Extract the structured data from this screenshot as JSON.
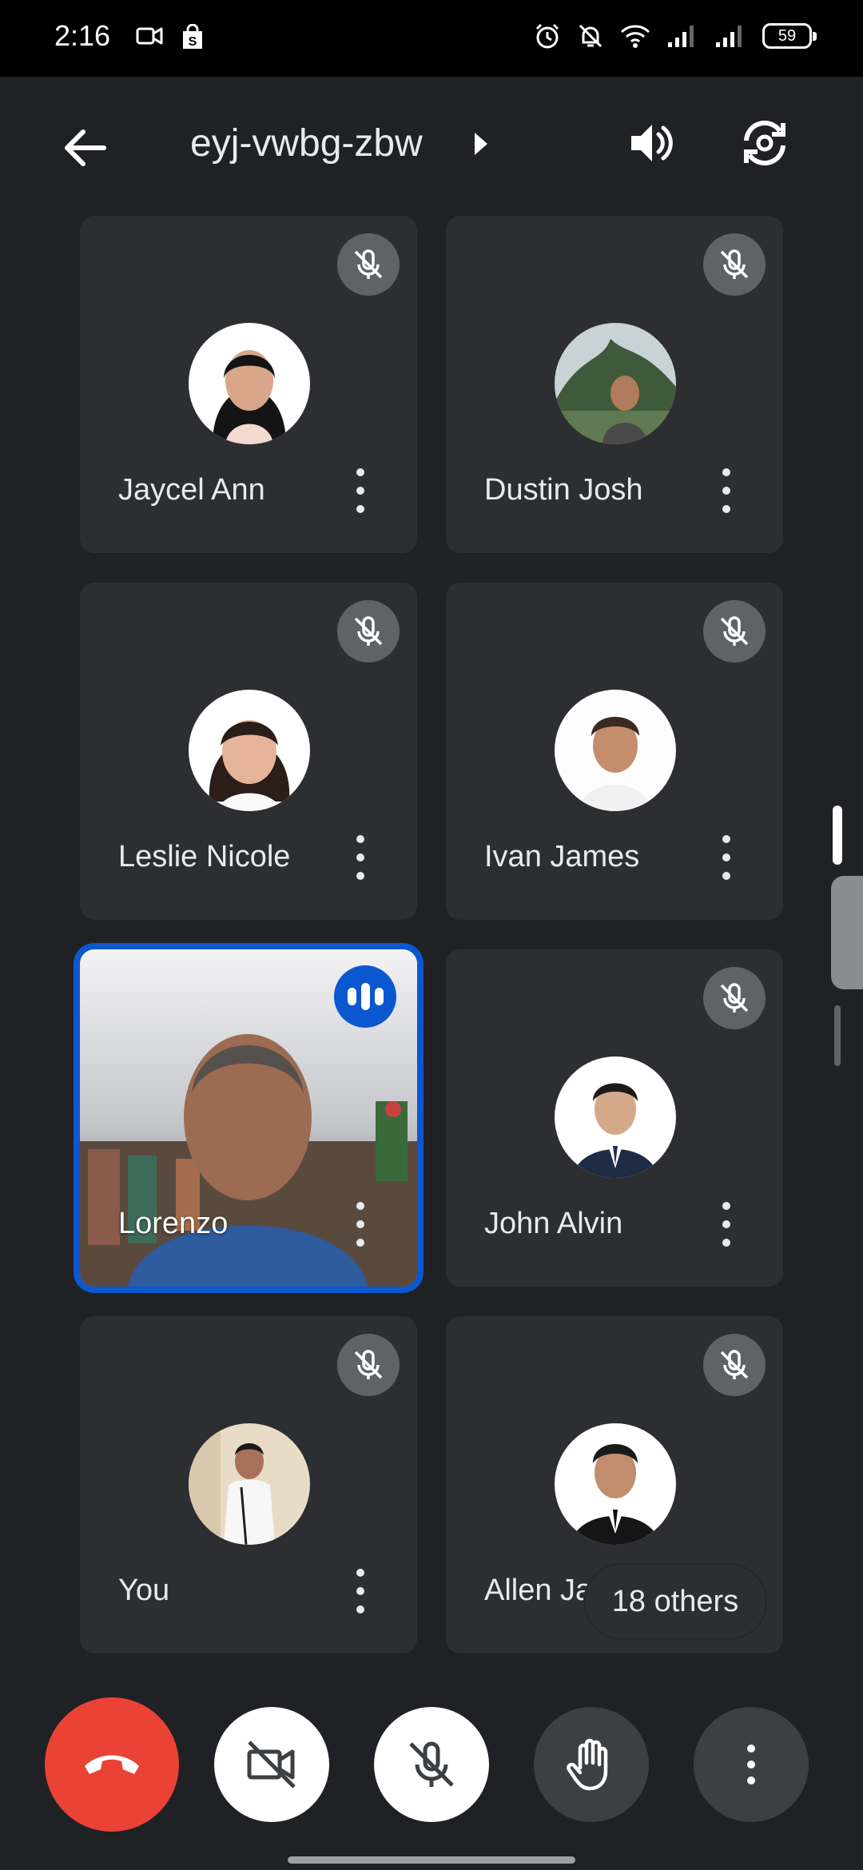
{
  "status_bar": {
    "time": "2:16",
    "battery": "59"
  },
  "header": {
    "meeting_code": "eyj-vwbg-zbw"
  },
  "participants": [
    {
      "name": "Jaycel Ann",
      "muted": true
    },
    {
      "name": "Dustin Josh",
      "muted": true
    },
    {
      "name": "Leslie Nicole",
      "muted": true
    },
    {
      "name": "Ivan James",
      "muted": true
    },
    {
      "name": "Lorenzo",
      "muted": false,
      "speaking": true,
      "video_on": true
    },
    {
      "name": "John Alvin",
      "muted": true
    },
    {
      "name": "You",
      "muted": true
    },
    {
      "name": "Allen James",
      "muted": true
    }
  ],
  "others_label": "18 others",
  "controls": [
    {
      "icon": "end-call-icon"
    },
    {
      "icon": "camera-off-icon"
    },
    {
      "icon": "mic-off-icon"
    },
    {
      "icon": "raise-hand-icon"
    },
    {
      "icon": "more-vert-icon"
    }
  ],
  "colors": {
    "end_call": "#ea4335",
    "active_speaker": "#0b57d0",
    "tile": "#2d2e31",
    "background": "#202124"
  }
}
